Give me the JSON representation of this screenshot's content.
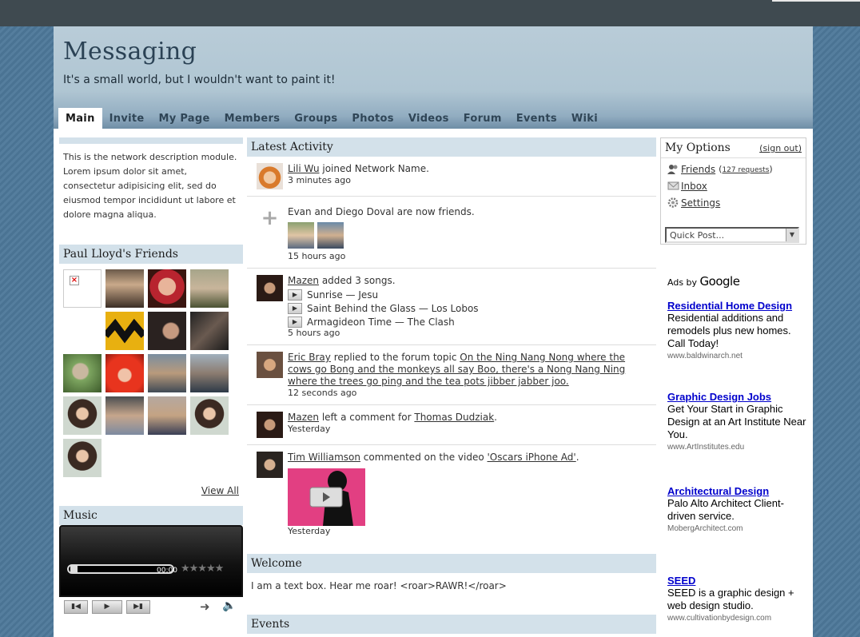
{
  "site": {
    "title": "Messaging",
    "tagline": "It's a small world, but I wouldn't want to paint it!"
  },
  "nav": {
    "tabs": [
      "Main",
      "Invite",
      "My Page",
      "Members",
      "Groups",
      "Photos",
      "Videos",
      "Forum",
      "Events",
      "Wiki"
    ],
    "active": "Main"
  },
  "left": {
    "description": "This is the network description module. Lorem ipsum dolor sit amet, consectetur adipisicing elit, sed do eiusmod tempor incididunt ut labore et dolore magna aliqua.",
    "friends_title": "Paul Lloyd's Friends",
    "view_all": "View All",
    "music_title": "Music",
    "player": {
      "time": "00:00",
      "progress": 0,
      "rating": 0
    }
  },
  "activity": {
    "title": "Latest Activity",
    "items": [
      {
        "user": "Lili Wu",
        "text": " joined Network Name.",
        "time": "3 minutes ago"
      },
      {
        "text": "Evan and Diego Doval are now friends.",
        "time": "15 hours ago"
      },
      {
        "user": "Mazen",
        "text": " added 3 songs.",
        "songs": [
          "Sunrise — Jesu",
          "Saint Behind the Glass — Los Lobos",
          "Armagideon Time — The Clash"
        ],
        "time": "5 hours ago"
      },
      {
        "user": "Eric Bray",
        "text": " replied to the forum topic ",
        "link": "On the Ning Nang Nong where the cows go Bong and the monkeys all say Boo, there's a Nong Nang Ning where the trees go ping and the tea pots jibber jabber joo.",
        "time": "12 seconds ago"
      },
      {
        "user": "Mazen",
        "text": " left a comment for ",
        "link": "Thomas Dudziak",
        "tail": ".",
        "time": "Yesterday"
      },
      {
        "user": "Tim Williamson",
        "text": " commented on the video ",
        "link": "'Oscars iPhone Ad'",
        "tail": ".",
        "time": "Yesterday"
      }
    ]
  },
  "welcome": {
    "title": "Welcome",
    "body": "I am a text box. Hear me roar! <roar>RAWR!</roar>"
  },
  "events": {
    "title": "Events"
  },
  "options": {
    "title": "My Options",
    "sign_out": "(sign out)",
    "friends": "Friends",
    "friends_requests": "127 requests",
    "inbox": "Inbox",
    "settings": "Settings",
    "quick_post": "Quick Post..."
  },
  "ads": {
    "label_prefix": "Ads by",
    "label_brand": "Google",
    "items": [
      {
        "title": "Residential Home Design",
        "desc": "Residential additions and remodels plus new homes. Call Today!",
        "url": "www.baldwinarch.net"
      },
      {
        "title": "Graphic Design Jobs",
        "desc": "Get Your Start in Graphic Design at an Art Institute Near You.",
        "url": "www.ArtInstitutes.edu"
      },
      {
        "title": "Architectural Design",
        "desc": "Palo Alto Architect Client-driven service.",
        "url": "MobergArchitect.com"
      },
      {
        "title": "SEED",
        "desc": "SEED is a graphic design + web design studio.",
        "url": "www.cultivationbydesign.com"
      }
    ]
  },
  "colors": {
    "accent": "#d3e1ea",
    "link_ad": "#0000cc",
    "header_bg": "#b0c6d3"
  }
}
